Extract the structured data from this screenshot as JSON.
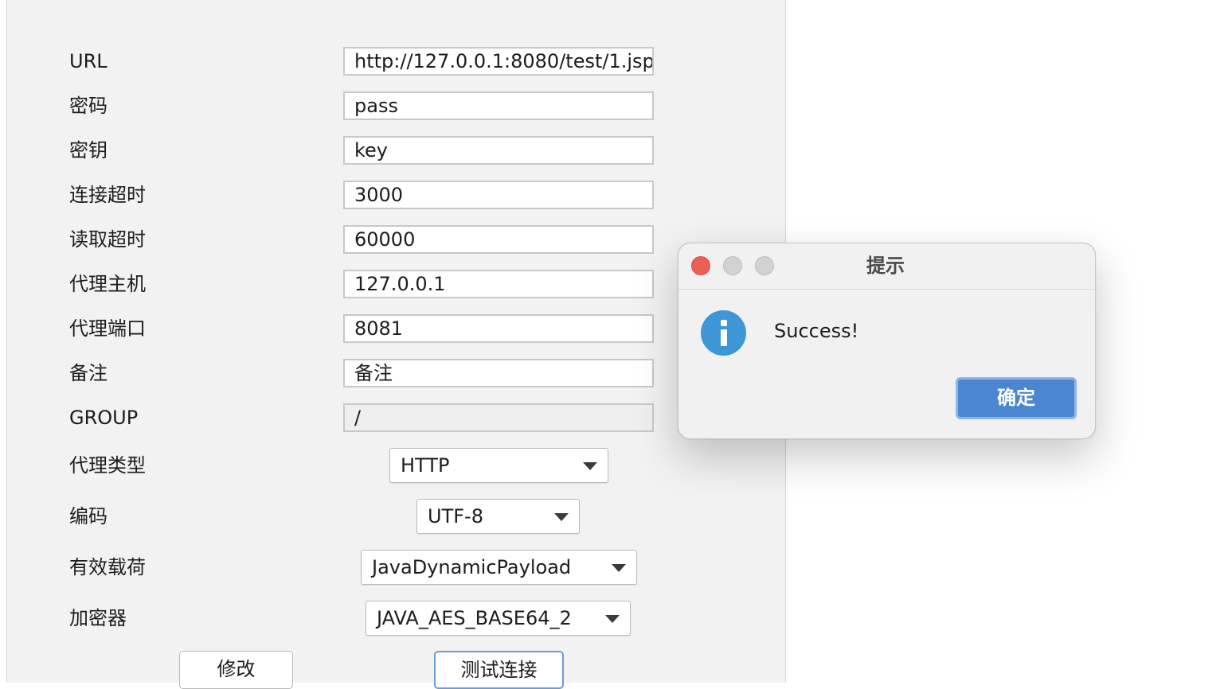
{
  "form": {
    "fields": [
      {
        "label": "URL",
        "value": "http://127.0.0.1:8080/test/1.jsp"
      },
      {
        "label": "密码",
        "value": "pass"
      },
      {
        "label": "密钥",
        "value": "key"
      },
      {
        "label": "连接超时",
        "value": "3000"
      },
      {
        "label": "读取超时",
        "value": "60000"
      },
      {
        "label": "代理主机",
        "value": "127.0.0.1"
      },
      {
        "label": "代理端口",
        "value": "8081"
      },
      {
        "label": "备注",
        "value": "备注"
      },
      {
        "label": "GROUP",
        "value": "/"
      }
    ],
    "selects": [
      {
        "label": "代理类型",
        "value": "HTTP"
      },
      {
        "label": "编码",
        "value": "UTF-8"
      },
      {
        "label": "有效载荷",
        "value": "JavaDynamicPayload"
      },
      {
        "label": "加密器",
        "value": "JAVA_AES_BASE64_2"
      }
    ],
    "buttons": {
      "modify": "修改",
      "test_connection": "测试连接"
    }
  },
  "dialog": {
    "title": "提示",
    "message": "Success!",
    "ok_label": "确定",
    "icon": "info-icon",
    "colors": {
      "icon": "#3d97d6",
      "ok_button": "#4a86d1",
      "close": "#ec5f57"
    }
  }
}
